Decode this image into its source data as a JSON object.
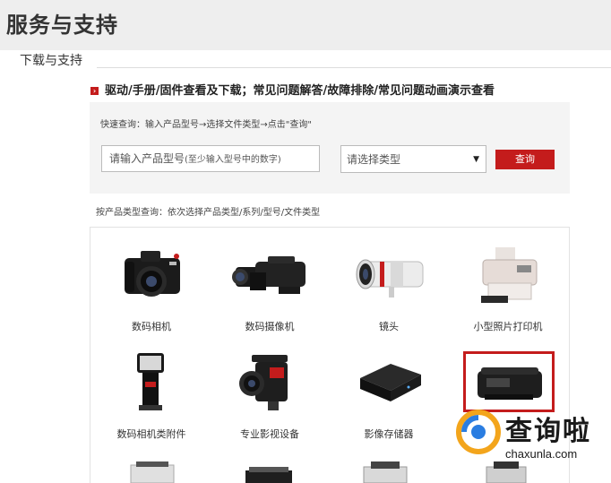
{
  "page": {
    "title": "服务与支持"
  },
  "subnav": {
    "label": "下载与支持"
  },
  "intro": {
    "bullet": "›",
    "text": "驱动/手册/固件查看及下载；常见问题解答/故障排除/常见问题动画演示查看"
  },
  "quick_search": {
    "label": "快速查询：输入产品型号→选择文件类型→点击\"查询\"",
    "input_placeholder": "请输入产品型号",
    "input_hint": "(至少输入型号中的数字)",
    "select_value": "请选择类型",
    "button_label": "查询"
  },
  "browse": {
    "label": "按产品类型查询：依次选择产品类型/系列/型号/文件类型"
  },
  "categories": [
    {
      "label": "数码相机",
      "icon": "dslr-camera-icon"
    },
    {
      "label": "数码摄像机",
      "icon": "camcorder-icon"
    },
    {
      "label": "镜头",
      "icon": "lens-icon"
    },
    {
      "label": "小型照片打印机",
      "icon": "photo-printer-icon"
    },
    {
      "label": "数码相机类附件",
      "icon": "flash-unit-icon"
    },
    {
      "label": "专业影视设备",
      "icon": "cinema-camera-icon"
    },
    {
      "label": "影像存储器",
      "icon": "storage-device-icon"
    },
    {
      "label": "",
      "icon": "inkjet-printer-icon",
      "selected": true
    }
  ],
  "watermark": {
    "logo_text": "查询啦",
    "url": "chaxunla.com"
  },
  "colors": {
    "accent": "#c41c1c",
    "header_bg": "#eeeeee",
    "panel_bg": "#f4f4f4"
  }
}
